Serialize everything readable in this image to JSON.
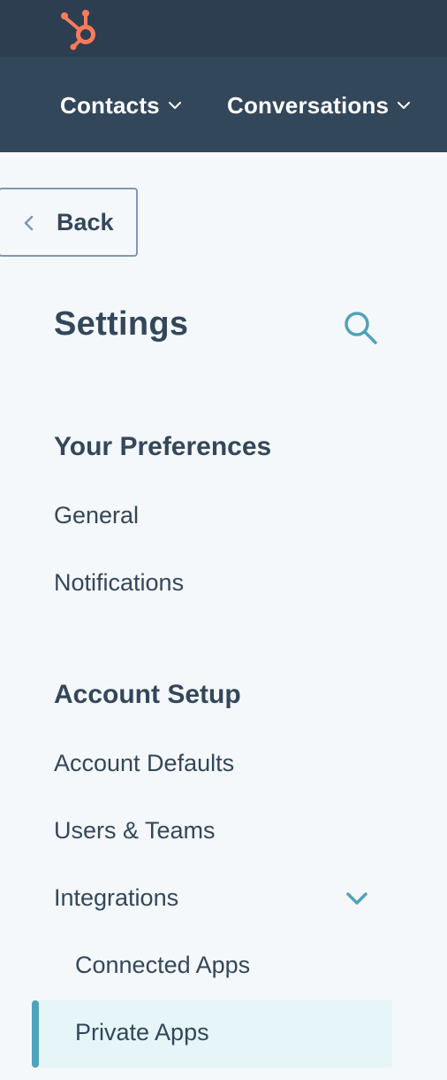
{
  "nav": {
    "logo": "hubspot-sprocket-logo",
    "items": [
      {
        "label": "Contacts"
      },
      {
        "label": "Conversations"
      }
    ]
  },
  "back_label": "Back",
  "settings": {
    "title": "Settings",
    "search_icon": "search-icon"
  },
  "sections": [
    {
      "heading": "Your Preferences",
      "items": [
        "General",
        "Notifications"
      ]
    },
    {
      "heading": "Account Setup",
      "items": [
        "Account Defaults",
        "Users & Teams",
        "Integrations"
      ],
      "integrations_children": [
        "Connected Apps",
        "Private Apps"
      ]
    }
  ],
  "active_item": "Private Apps",
  "colors": {
    "topbar": "#2d3e50",
    "navbar": "#33475b",
    "brand_orange": "#ff7a59",
    "accent_teal": "#4fa3b9",
    "active_bg": "#e5f5f8",
    "text": "#33475b"
  }
}
